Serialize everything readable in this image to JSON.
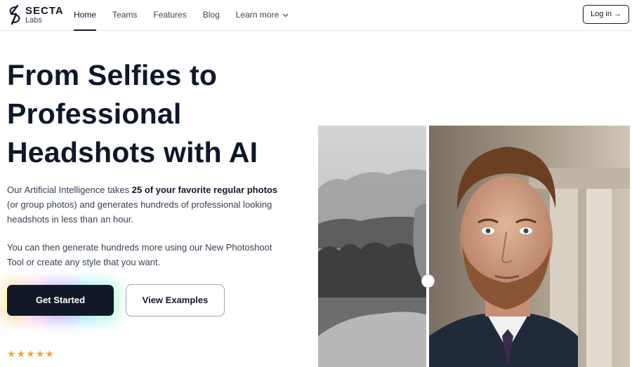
{
  "brand": {
    "name": "SECTA",
    "sub": "Labs"
  },
  "nav": {
    "items": [
      {
        "label": "Home",
        "active": true
      },
      {
        "label": "Teams"
      },
      {
        "label": "Features"
      },
      {
        "label": "Blog"
      },
      {
        "label": "Learn more"
      }
    ],
    "login_label": "Log in →"
  },
  "hero": {
    "title_lines": [
      "From Selfies to",
      "Professional",
      "Headshots with AI"
    ],
    "p1_before": "Our Artificial Intelligence takes ",
    "p1_bold": "25 of your favorite regular photos",
    "p1_after": " (or group photos) and generates hundreds of professional looking headshots in less than an hour.",
    "p2": "You can then generate hundreds more using our New Photoshoot Tool or create any style that you want.",
    "cta_primary": "Get Started",
    "cta_secondary": "View Examples"
  },
  "rating": {
    "stars": 5
  },
  "colors": {
    "primary": "#111827",
    "star": "#f5a623",
    "text": "#374151"
  },
  "icons": {
    "dropdown": "chevron-down-icon",
    "star": "star-icon"
  }
}
